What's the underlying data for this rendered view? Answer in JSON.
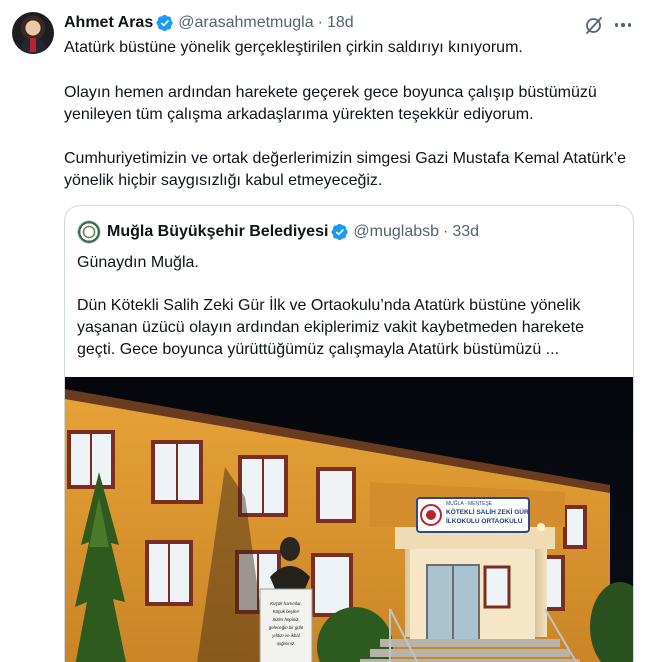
{
  "tweet": {
    "author_name": "Ahmet Aras",
    "handle": "@arasahmetmugla",
    "separator": "·",
    "time": "18d",
    "paragraph1": "Atatürk büstüne yönelik gerçekleştirilen çirkin saldırıyı kınıyorum.",
    "paragraph2": "Olayın hemen ardından harekete geçerek gece boyunca çalışıp büstümüzü yenileyen tüm çalışma arkadaşlarıma yürekten teşekkür ediyorum.",
    "paragraph3": "Cumhuriyetimizin ve ortak değerlerimizin simgesi Gazi Mustafa Kemal Atatürk’e yönelik hiçbir saygısızlığı kabul etmeyeceğiz."
  },
  "quote": {
    "author_name": "Muğla Büyükşehir Belediyesi",
    "handle": "@muglabsb",
    "separator": "·",
    "time": "33d",
    "paragraph1": "Günaydın Muğla.",
    "paragraph2": "Dün Kötekli Salih Zeki Gür İlk ve Ortaokulu’nda Atatürk büstüne yönelik yaşanan üzücü olayın ardından ekiplerimiz vakit kaybetmeden harekete geçti. Gece boyunca yürüttüğümüz çalışmayla Atatürk büstümüzü ...",
    "photo": {
      "sign_line1": "MUĞLA - MENTEŞE",
      "sign_line2": "KÖTEKLİ SALİH ZEKİ GÜR",
      "sign_line3": "İLKOKULU ORTAOKULU",
      "plaque_line1": "Küçük hanımlar,",
      "plaque_line2": "Küçük beyler!",
      "plaque_line3": "Sizler hepiniz,",
      "plaque_line4": "geleceğin bir gülü",
      "plaque_line5": "yıldızı ve ikbal",
      "plaque_line6": "ışığısınız."
    }
  },
  "icons": {
    "verified": "verified-badge-icon",
    "grok": "grok-icon",
    "more": "more-options-icon"
  },
  "colors": {
    "verified_blue": "#1d9bf0",
    "text_primary": "#0f1419",
    "text_secondary": "#536471",
    "border": "#cfd9de"
  }
}
